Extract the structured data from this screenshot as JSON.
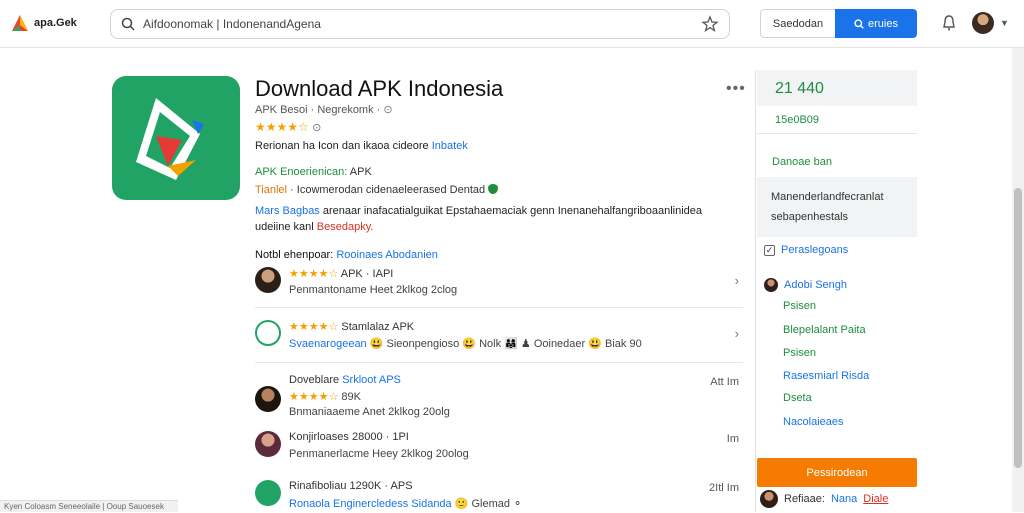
{
  "brand": {
    "name": "apa.Gek"
  },
  "search": {
    "value": "Aifdoonomak | IndonenandAgena"
  },
  "header": {
    "secondary_button": "Saedodan",
    "primary_button": "eruies"
  },
  "app": {
    "title": "Download APK Indonesia",
    "developer": "APK Besoi · Negrekomk ·",
    "rating_stars": "★★★★☆",
    "desc_text": "Rerionan ha Icon dan ikaoa cideore ",
    "desc_link": "Inbatek",
    "green_tag_label": "APK Enoerienican:",
    "green_tag_value": " APK",
    "orange_tag_label": "Tianlel",
    "orange_tag_value": " · Icowmerodan cidenaeleerased Dentad",
    "long_desc_blue": "Mars Bagbas",
    "long_desc_text": " arenaar inafacatialguikat Epstahaemaciak genn Inenanehalfangriboaanlinidea udeiine kanl ",
    "long_desc_red": "Besedapky."
  },
  "reviews": {
    "head_label": "Notbl ehenpoar: ",
    "head_link": "Rooinaes Abodanien",
    "items": [
      {
        "stars": "★★★★☆",
        "line1_text": " APK · IAPI",
        "line2_text": "Penmantoname Heet 2klkog 2clog",
        "right": "›"
      },
      {
        "stars": "★★★★☆",
        "line1_text": " Stamlalaz APK",
        "line2_blue": "Svaenarogeean",
        "line2_text": " 😃 Sieonpengioso 😃 Nolk 👨‍👩‍👧 ♟ Ooinedaer 😃 Biak 90",
        "right": "›"
      },
      {
        "title": "Doveblare",
        "title_blue": " Srkloot APS",
        "stars": "★★★★☆",
        "line1_text": " 89K",
        "line2_text": "Bnmaniaaeme Anet 2klkog 20olg",
        "right": "Att Im"
      },
      {
        "title": "Konjirloases",
        "line1_text": " 28000 · 1PI",
        "line2_text": "Penmanerlacme Heey 2klkog 20olog",
        "right": "Im"
      },
      {
        "title": "Rinafiboliau",
        "line1_text": " 1290K · APS",
        "line2_blue": "Ronaola Enginercledess Sidanda",
        "line2_text": " 🙂 Glemad ⚬",
        "right": "2Itl Im"
      }
    ]
  },
  "sidebar": {
    "stat_big": "21 440",
    "stat_small": "15e0B09",
    "label": "Danoae ban",
    "box_line1": "Manenderlandfecranlat",
    "box_line2": "sebapenhestals",
    "check_label": "Peraslegoans",
    "person_name": "Adobi Sengh",
    "links": [
      {
        "text": "Psisen",
        "tone": "green"
      },
      {
        "text": "Blepelalant Paita",
        "tone": "green"
      },
      {
        "text": "Psisen",
        "tone": "green"
      },
      {
        "text": "Rasesmiarl Risda",
        "tone": "blue"
      },
      {
        "text": "Dseta",
        "tone": "green"
      },
      {
        "text": "Nacolaieaes",
        "tone": "blue"
      }
    ],
    "orange_button": "Pessirodean",
    "foot_text": "Refiaae:",
    "foot_blue": "Nana",
    "foot_red": "Diale"
  },
  "statusbar": {
    "text": "Kyen Coloasm Seneeolaile | Ooup Sauoesek"
  },
  "colors": {
    "accent": "#1a73e8",
    "green": "#1e8e3e",
    "orange": "#f57c00",
    "star": "#f4a100",
    "app_icon": "#22a366"
  }
}
